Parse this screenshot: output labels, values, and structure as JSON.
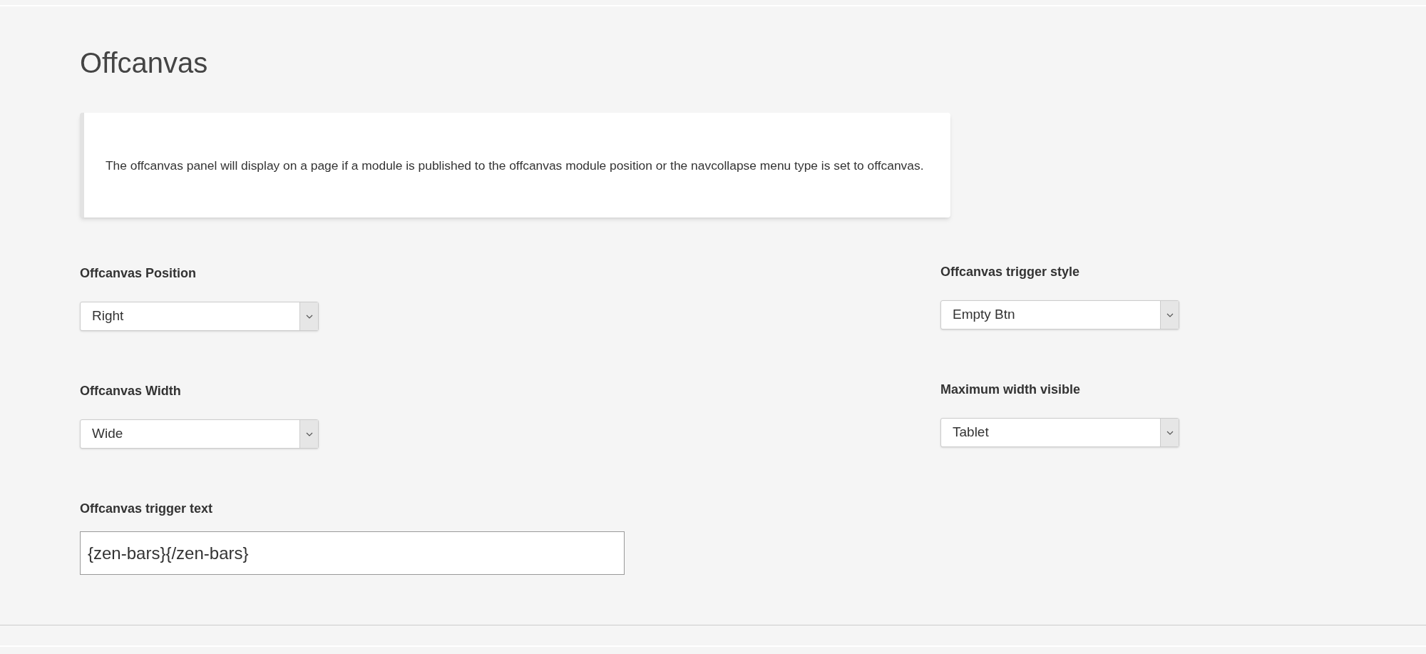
{
  "title": "Offcanvas",
  "notice": "The offcanvas panel will display on a page if a module is published to the offcanvas module position or the navcollapse menu type is set to offcanvas.",
  "fields": [
    {
      "kind": "select",
      "label": "Offcanvas Position",
      "value": "Right"
    },
    {
      "kind": "select",
      "label": "Offcanvas trigger style",
      "value": "Empty Btn"
    },
    {
      "kind": "select",
      "label": "Offcanvas Width",
      "value": "Wide"
    },
    {
      "kind": "select",
      "label": "Maximum width visible",
      "value": "Tablet"
    },
    {
      "kind": "text",
      "label": "Offcanvas trigger text",
      "value": "{zen-bars}{/zen-bars}"
    }
  ]
}
